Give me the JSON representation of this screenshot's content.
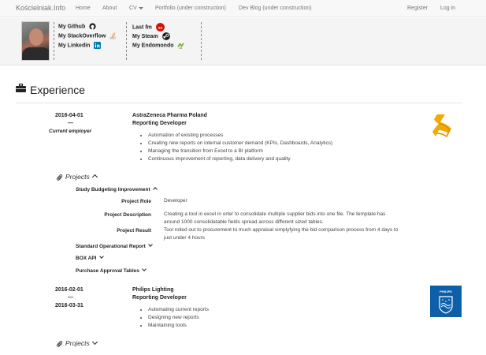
{
  "nav": {
    "brand": "Kościelniak.Info",
    "items": [
      "Home",
      "About",
      "CV",
      "Portfolio (under construction)",
      "Dev Blog (under construction)"
    ],
    "right": [
      "Register",
      "Log in"
    ]
  },
  "profile": {
    "links_left": [
      "My Github",
      "My StackOverflow",
      "My Linkedin"
    ],
    "links_right": [
      "Last fm",
      "My Steam",
      "My Endomondo"
    ]
  },
  "section": {
    "title": "Experience"
  },
  "jobs": [
    {
      "start": "2016-04-01",
      "dash": "—",
      "end": "Current employer",
      "company": "AstraZeneca Pharma Poland",
      "role": "Reporting Developer",
      "duties": [
        "Automation of existing processes",
        "Creating new reports on internal customer demand (KPIs, Dashboards, Analytics)",
        "Managing the transition from Excel to a BI platform",
        "Continuous improvement of reporting, data delivery and quality"
      ],
      "projects_label": "Projects",
      "projects": [
        {
          "name": "Study Budgeting Improvement",
          "details": [
            {
              "label": "Project Role",
              "value": "Developer"
            },
            {
              "label": "Project Description",
              "value": "Creating a tool in excel in orter to consolidate multiple supplier bids into one file. The template has around 1000 consolidatable fields spread across different sized tables."
            },
            {
              "label": "Project Result",
              "value": "Tool rolled out to procurement to much appraisal simplyfying the bid comparison process from 4 days to just under 4 hours"
            }
          ]
        },
        {
          "name": "Standard Operational Report"
        },
        {
          "name": "BOX API"
        },
        {
          "name": "Purchase Approval Tables"
        }
      ]
    },
    {
      "start": "2016-02-01",
      "dash": "—",
      "end": "2016-03-31",
      "company": "Philips Lighting",
      "role": "Reporting Developer",
      "duties": [
        "Automating current reports",
        "Designing new reports",
        "Maintaining tools"
      ],
      "projects_label": "Projects",
      "logo_text": "PHILIPS"
    }
  ],
  "colors": {
    "lastfm": "#d51007",
    "github": "#222222",
    "linkedin": "#0077b5",
    "steam": "#171a21",
    "endomondo": "#7bb33b",
    "stackoverflow": "#f48024",
    "astrazeneca": "#f0ab00",
    "philips": "#0d5fa8"
  }
}
